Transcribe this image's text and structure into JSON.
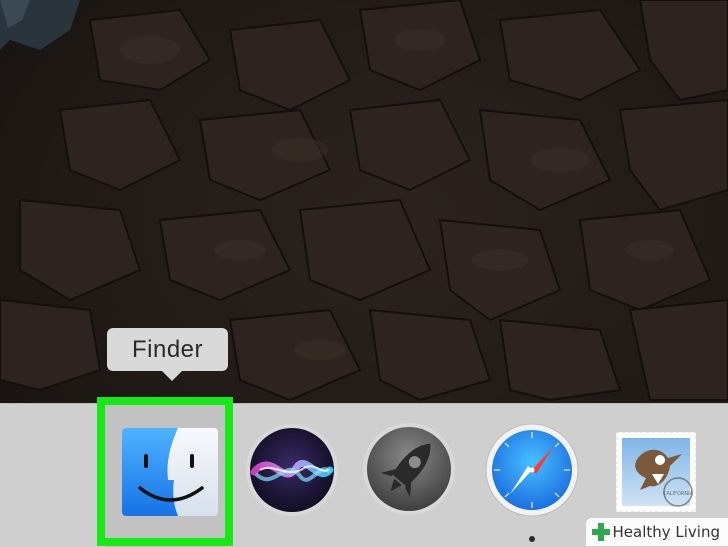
{
  "tooltip": {
    "label": "Finder"
  },
  "dock": {
    "items": [
      {
        "name": "Finder",
        "icon": "finder-icon",
        "highlighted": true
      },
      {
        "name": "Siri",
        "icon": "siri-icon"
      },
      {
        "name": "Launchpad",
        "icon": "launchpad-rocket-icon"
      },
      {
        "name": "Safari",
        "icon": "safari-compass-icon",
        "running": true
      },
      {
        "name": "Mail",
        "icon": "mail-stamp-icon"
      }
    ]
  },
  "mail_stamp": {
    "text": "CALIFORNIA"
  },
  "watermark": {
    "text": "Healthy Living",
    "icon": "plus-cross-icon"
  },
  "colors": {
    "highlight": "#16e916",
    "dock_background": "#cfcfcf",
    "tooltip_background": "#d9d9d9",
    "finder_blue": "#1f8ff0"
  }
}
